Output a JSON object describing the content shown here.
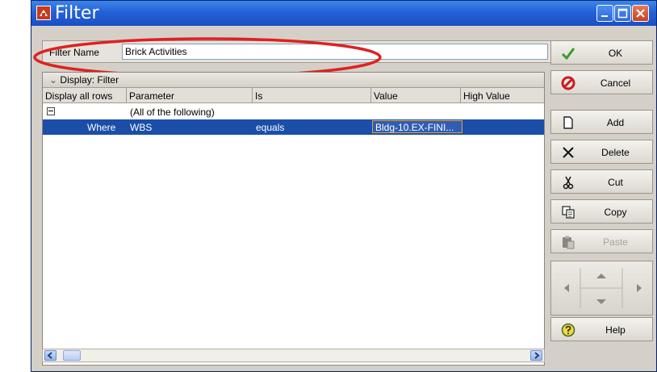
{
  "window": {
    "title": "Filter",
    "controls": [
      "minimize-icon",
      "maximize-icon",
      "close-icon"
    ],
    "titlebar_color": "#2461d6"
  },
  "filter_name": {
    "label": "Filter Name",
    "value": "Brick Activities",
    "highlight_color": "#e02020"
  },
  "grid": {
    "display_label": "Display: Filter",
    "columns": [
      "Display all rows",
      "Parameter",
      "Is",
      "Value",
      "High Value"
    ],
    "rows": [
      {
        "display": "",
        "parameter": "(All of the following)",
        "is": "",
        "value": "",
        "high_value": "",
        "expander": "collapse-icon"
      },
      {
        "display": "Where",
        "parameter": "WBS",
        "is": "equals",
        "value": "Bldg-10.EX-FINI...",
        "high_value": "",
        "selected": true
      }
    ],
    "selection_color": "#1a4ea8"
  },
  "actions": {
    "ok": "OK",
    "cancel": "Cancel",
    "add": "Add",
    "delete": "Delete",
    "cut": "Cut",
    "copy": "Copy",
    "paste": "Paste",
    "help": "Help"
  },
  "icons": {
    "ok": "checkmark-icon",
    "cancel": "cancel-icon",
    "add": "new-page-icon",
    "delete": "x-icon",
    "cut": "scissors-icon",
    "copy": "copy-icon",
    "paste": "paste-icon",
    "help": "help-icon",
    "nav": [
      "arrow-left-icon",
      "arrow-up-icon",
      "arrow-down-icon",
      "arrow-right-icon"
    ]
  }
}
